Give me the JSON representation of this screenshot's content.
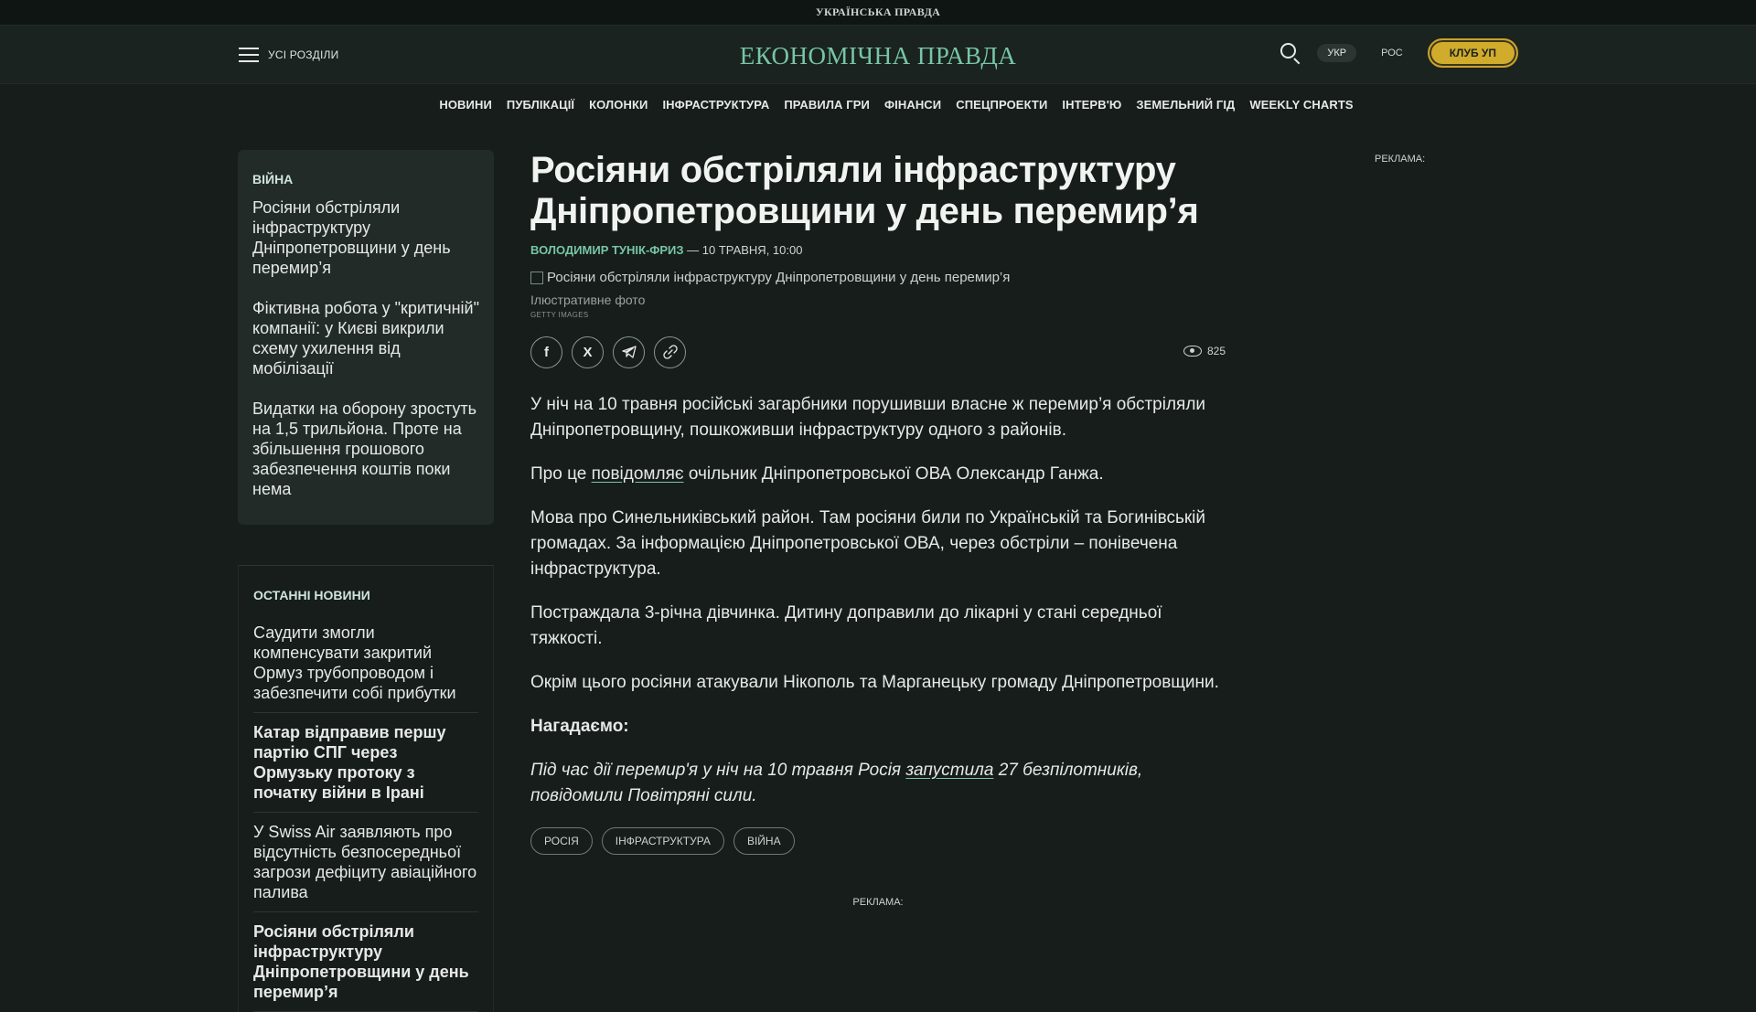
{
  "topbar": {
    "logo": "УКРАЇНСЬКА ПРАВДА"
  },
  "header": {
    "menu_label": "УСІ РОЗДІЛИ",
    "logo": "ЕКОНОМІЧНА ПРАВДА",
    "lang_ukr": "УКР",
    "lang_ros": "РОС",
    "club_label": "КЛУБ УП"
  },
  "nav": [
    "НОВИНИ",
    "ПУБЛІКАЦІЇ",
    "КОЛОНКИ",
    "ІНФРАСТРУКТУРА",
    "ПРАВИЛА ГРИ",
    "ФІНАНСИ",
    "СПЕЦПРОЕКТИ",
    "ІНТЕРВ'Ю",
    "ЗЕМЕЛЬНИЙ ГІД",
    "WEEKLY CHARTS"
  ],
  "sidebar": {
    "war": {
      "title": "ВІЙНА",
      "items": [
        "Росіяни обстріляли інфраструктуру Дніпропетровщини у день перемир’я",
        "Фіктивна робота у \"критичній\" компанії: у Києві викрили схему ухилення від мобілізації",
        "Видатки на оборону зростуть на 1,5 трильйона. Проте на збільшення грошового забезпечення коштів поки нема"
      ]
    },
    "latest": {
      "title": "ОСТАННІ НОВИНИ",
      "items": [
        "Саудити змогли компенсувати закритий Ормуз трубопроводом і забезпечити собі прибутки",
        "Катар відправив першу партію СПГ через Ормузьку протоку з початку війни в Ірані",
        "У Swiss Air заявляють про відсутність безпосередньої загрози дефіциту авіаційного палива",
        "Росіяни обстріляли інфраструктуру Дніпропетровщини у день перемир’я"
      ]
    }
  },
  "article": {
    "headline": "Росіяни обстріляли інфраструктуру Дніпропетровщини у день перемир’я",
    "author": "ВОЛОДИМИР ТУНІК-ФРИЗ",
    "date": "— 10 ТРАВНЯ, 10:00",
    "image_alt": "Росіяни обстріляли інфраструктуру Дніпропетровщини у день перемир’я",
    "caption": "Ілюстративне фото",
    "credit": "GETTY IMAGES",
    "views": "825",
    "p1": "У ніч на 10 травня російські загарбники порушивши власне ж перемир’я обстріляли Дніпропетровщину, пошкоживши інфраструктуру одного з районів.",
    "p2_pre": "Про це ",
    "p2_link": "повідомляє",
    "p2_post": " очільник Дніпропетровської ОВА Олександр Ганжа.",
    "p3": "Мова про Синельниківський район. Там росіяни били по Українській та Богинівській громадах. За інформацією Дніпропетровської ОВА, через обстріли – понівечена інфраструктура.",
    "p4": "Постраждала 3-річна дівчинка. Дитину доправили до лікарні у стані середньої тяжкості.",
    "p5": "Окрім цього росіяни атакували Нікополь та Марганецьку громаду Дніпропетровщини.",
    "reminder": "Нагадаємо:",
    "q_pre": "Під час дії перемир'я у ніч на 10 травня Росія ",
    "q_link": "запустила",
    "q_post": " 27 безпілотників, повідомили Повітряні сили.",
    "tags": [
      "РОСІЯ",
      "ІНФРАСТРУКТУРА",
      "ВІЙНА"
    ]
  },
  "ads": {
    "right": "РЕКЛАМА:",
    "bottom": "РЕКЛАМА:"
  },
  "icons": {
    "facebook": "facebook-icon",
    "x": "x-icon",
    "telegram": "telegram-icon",
    "link": "link-icon",
    "eye": "eye-icon",
    "search": "search-icon",
    "menu": "menu-icon"
  }
}
